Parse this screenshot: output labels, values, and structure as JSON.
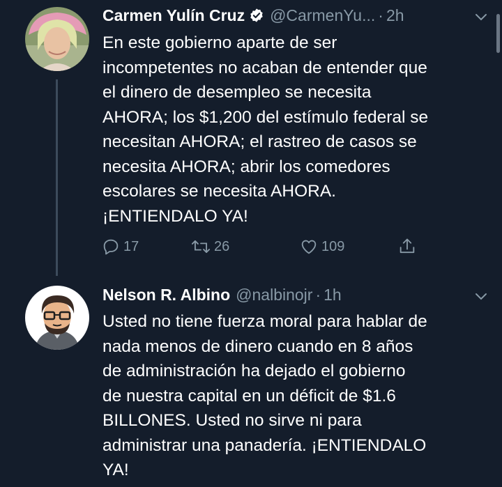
{
  "colors": {
    "background": "#141d2b",
    "text_primary": "#ffffff",
    "text_secondary": "#8899a6",
    "thread_line": "#3d4b5c"
  },
  "tweets": [
    {
      "author_name": "Carmen Yulín Cruz",
      "verified": true,
      "verified_icon": "verified-badge-icon",
      "handle": "@CarmenYu...",
      "dot": "·",
      "time": "2h",
      "menu_icon": "chevron-down-icon",
      "body_lines": [
        "En este gobierno aparte de ser",
        "incompetentes no acaban de entender que",
        "el dinero de desempleo se necesita",
        "AHORA; los $1,200 del estímulo federal se",
        "necesitan AHORA; el rastreo de casos se",
        "necesita AHORA; abrir los comedores",
        "escolares se necesita AHORA.",
        "¡ENTIENDALO YA!"
      ],
      "actions": {
        "reply_count": "17",
        "retweet_count": "26",
        "like_count": "109"
      }
    },
    {
      "author_name": "Nelson R. Albino",
      "verified": false,
      "handle": "@nalbinojr",
      "dot": "·",
      "time": "1h",
      "menu_icon": "chevron-down-icon",
      "body_lines": [
        "Usted no tiene fuerza moral para hablar de",
        "nada menos de dinero cuando en 8 años",
        "de administración ha dejado el gobierno",
        "de nuestra capital en un déficit de $1.6",
        "BILLONES. Usted no sirve ni para",
        "administrar una panadería. ¡ENTIENDALO",
        "YA!"
      ]
    }
  ]
}
